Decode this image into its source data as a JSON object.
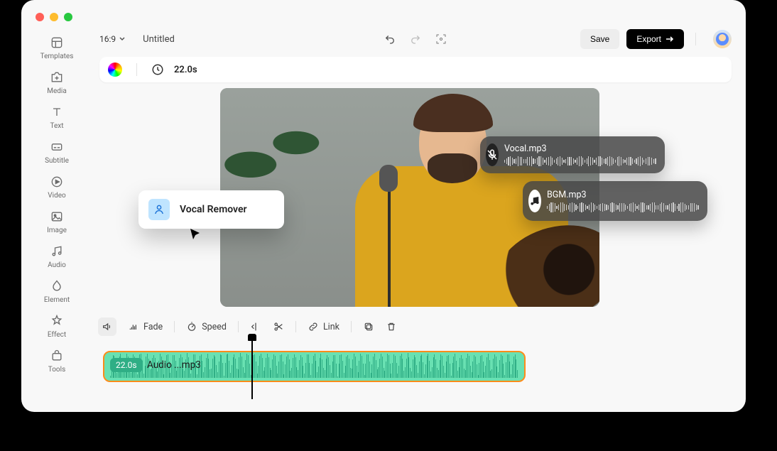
{
  "header": {
    "aspect": "16:9",
    "title": "Untitled",
    "save_label": "Save",
    "export_label": "Export"
  },
  "infobar": {
    "duration": "22.0s"
  },
  "sidebar": {
    "items": [
      {
        "label": "Templates"
      },
      {
        "label": "Media"
      },
      {
        "label": "Text"
      },
      {
        "label": "Subtitle"
      },
      {
        "label": "Video"
      },
      {
        "label": "Image"
      },
      {
        "label": "Audio"
      },
      {
        "label": "Element"
      },
      {
        "label": "Effect"
      },
      {
        "label": "Tools"
      }
    ]
  },
  "contextmenu": {
    "label": "Vocal Remover"
  },
  "overlay": {
    "vocal": {
      "name": "Vocal.mp3"
    },
    "bgm": {
      "name": "BGM.mp3"
    }
  },
  "toolbar": {
    "fade": "Fade",
    "speed": "Speed",
    "link": "Link"
  },
  "track": {
    "time": "22.0s",
    "name": "Audio ...mp3"
  }
}
